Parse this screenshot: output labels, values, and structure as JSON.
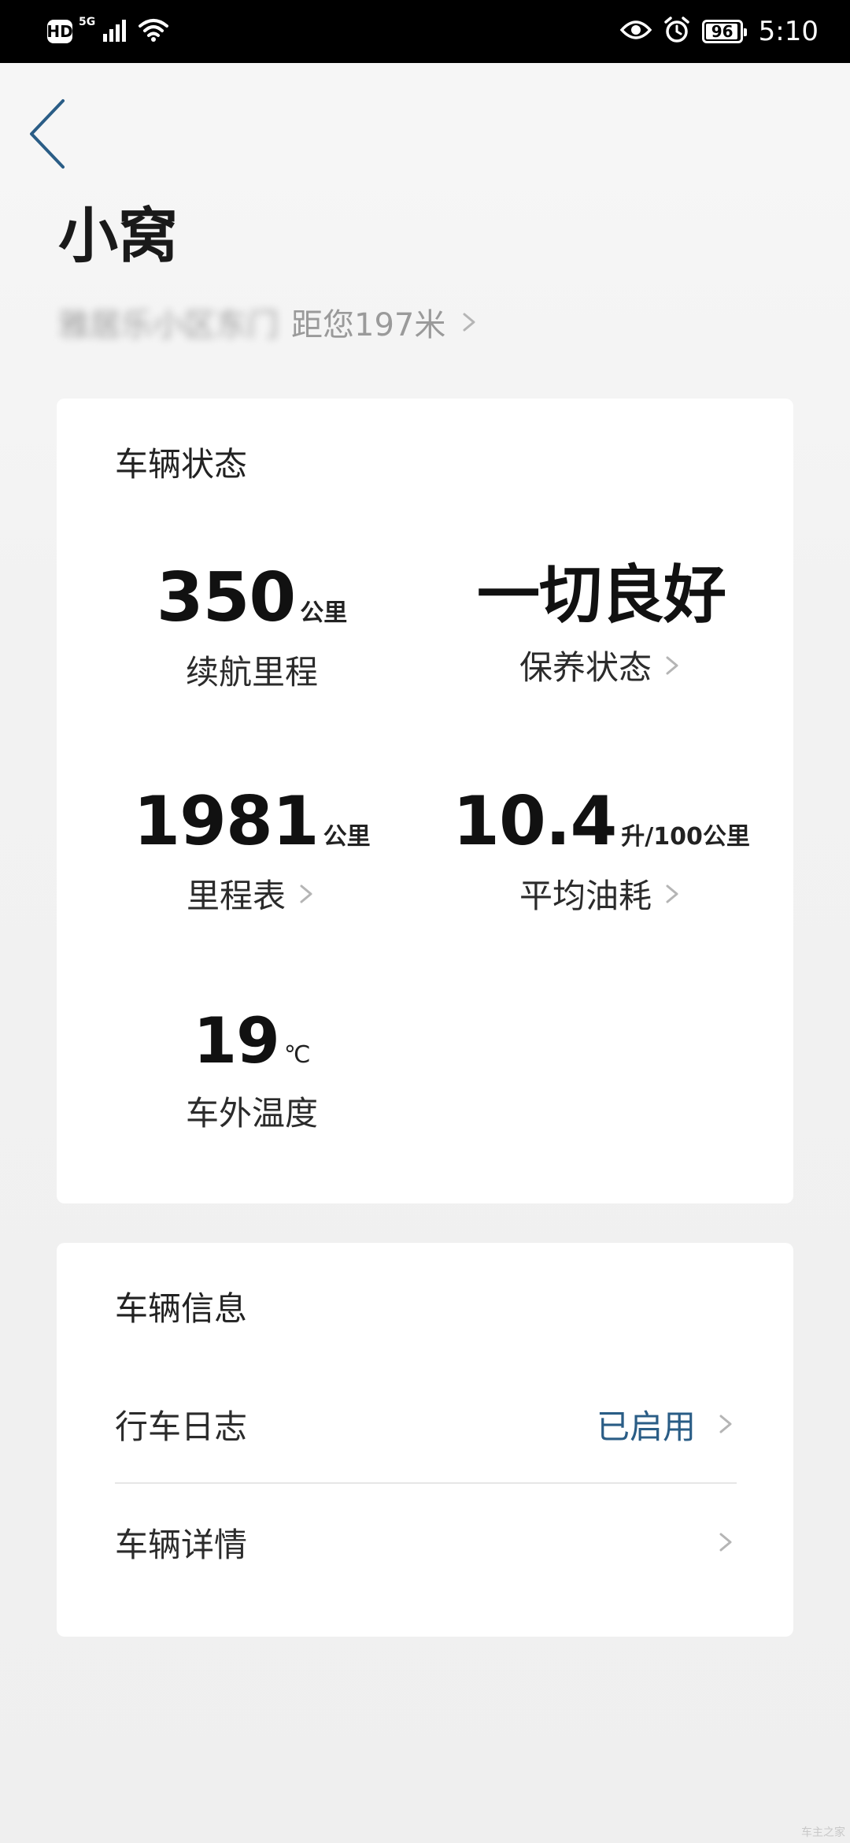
{
  "status_bar": {
    "hd": "HD",
    "network": "5G",
    "battery_level": "96",
    "time": "5:10"
  },
  "header": {
    "title": "小窝",
    "address": "雅居乐小区东门",
    "distance": "距您197米"
  },
  "vehicle_status": {
    "title": "车辆状态",
    "items": [
      {
        "value": "350",
        "unit": "公里",
        "label": "续航里程",
        "has_chevron": false
      },
      {
        "value": "一切良好",
        "unit": "",
        "label": "保养状态",
        "has_chevron": true
      },
      {
        "value": "1981",
        "unit": "公里",
        "label": "里程表",
        "has_chevron": true
      },
      {
        "value": "10.4",
        "unit": "升/100公里",
        "label": "平均油耗",
        "has_chevron": true
      },
      {
        "value": "19",
        "unit": "℃",
        "label": "车外温度",
        "has_chevron": false
      }
    ]
  },
  "vehicle_info": {
    "title": "车辆信息",
    "rows": [
      {
        "label": "行车日志",
        "status": "已启用"
      },
      {
        "label": "车辆详情",
        "status": ""
      }
    ]
  },
  "watermark": "车主之家",
  "colors": {
    "accent": "#2a5d86",
    "status_bar_bg": "#000000",
    "card_bg": "#ffffff",
    "chevron": "#b5b5b5"
  },
  "icons": {
    "back": "chevron-left-icon",
    "signal": "signal-icon",
    "wifi": "wifi-icon",
    "eye": "eye-icon",
    "alarm": "alarm-icon",
    "battery": "battery-icon",
    "chevron": "chevron-right-icon"
  }
}
